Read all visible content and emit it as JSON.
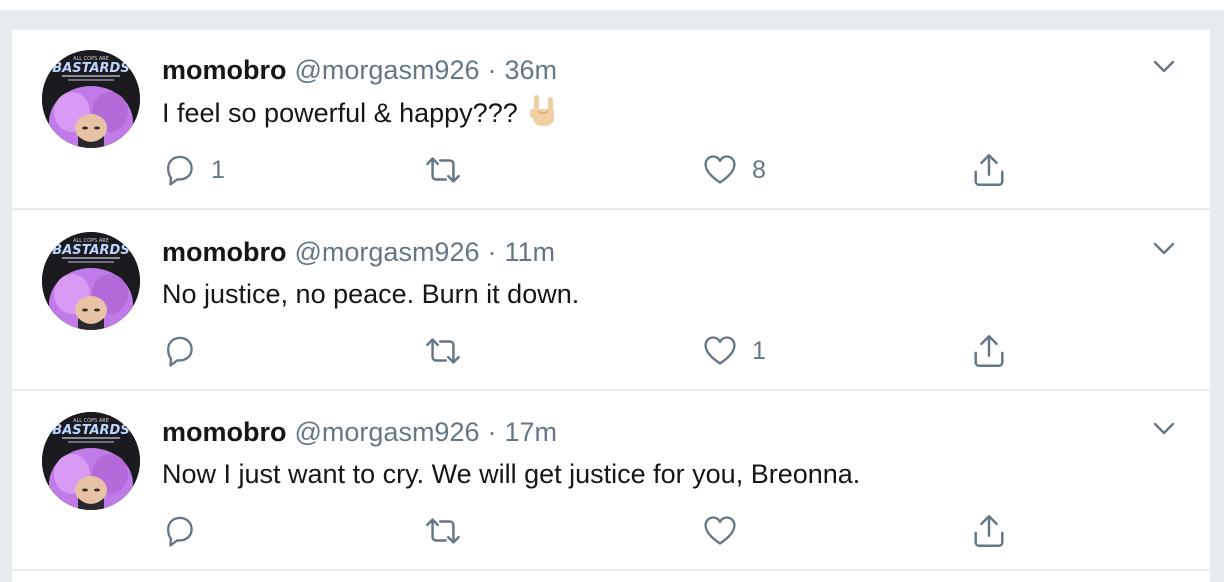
{
  "colors": {
    "background": "#e6ecf0",
    "card": "#ffffff",
    "text_primary": "#14171a",
    "text_secondary": "#657786"
  },
  "tweets": [
    {
      "name": "momobro",
      "handle": "@morgasm926",
      "separator": "·",
      "time": "36m",
      "text": "I feel so powerful & happy???",
      "emoji": "sign-of-horns",
      "reply_count": "1",
      "retweet_count": "",
      "like_count": "8"
    },
    {
      "name": "momobro",
      "handle": "@morgasm926",
      "separator": "·",
      "time": "11m",
      "text": "No justice, no peace. Burn it down.",
      "reply_count": "",
      "retweet_count": "",
      "like_count": "1"
    },
    {
      "name": "momobro",
      "handle": "@morgasm926",
      "separator": "·",
      "time": "17m",
      "text": "Now I just want to cry. We will get justice for you, Breonna.",
      "reply_count": "",
      "retweet_count": "",
      "like_count": ""
    }
  ],
  "icons": {
    "reply": "reply-icon",
    "retweet": "retweet-icon",
    "like": "heart-icon",
    "share": "share-icon",
    "menu": "chevron-down-icon"
  }
}
